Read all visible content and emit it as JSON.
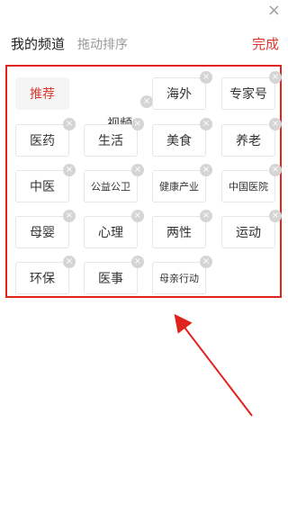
{
  "header": {
    "close_glyph": "×",
    "title": "我的频道",
    "subtitle": "拖动排序",
    "done_label": "完成"
  },
  "tiles": [
    {
      "id": "recommend",
      "label": "推荐",
      "removable": false,
      "style": "highlight"
    },
    {
      "id": "video",
      "label": "视频",
      "removable": true,
      "style": "floating"
    },
    {
      "id": "overseas",
      "label": "海外",
      "removable": true
    },
    {
      "id": "expert",
      "label": "专家号",
      "removable": true
    },
    {
      "id": "medicine",
      "label": "医药",
      "removable": true
    },
    {
      "id": "life",
      "label": "生活",
      "removable": true
    },
    {
      "id": "food",
      "label": "美食",
      "removable": true
    },
    {
      "id": "elderly",
      "label": "养老",
      "removable": true
    },
    {
      "id": "tcm",
      "label": "中医",
      "removable": true
    },
    {
      "id": "public-health",
      "label": "公益公卫",
      "removable": true,
      "small": true
    },
    {
      "id": "health-industry",
      "label": "健康产业",
      "removable": true,
      "small": true
    },
    {
      "id": "china-hospital",
      "label": "中国医院",
      "removable": true,
      "small": true
    },
    {
      "id": "maternal",
      "label": "母婴",
      "removable": true
    },
    {
      "id": "psychology",
      "label": "心理",
      "removable": true
    },
    {
      "id": "sex",
      "label": "两性",
      "removable": true
    },
    {
      "id": "sports",
      "label": "运动",
      "removable": true
    },
    {
      "id": "environment",
      "label": "环保",
      "removable": true
    },
    {
      "id": "medical-affairs",
      "label": "医事",
      "removable": true
    },
    {
      "id": "mother-action",
      "label": "母亲行动",
      "removable": true,
      "small": true
    }
  ],
  "remove_glyph": "×",
  "colors": {
    "accent": "#d8382f",
    "annotation": "#e0231d",
    "remove_badge": "#d5d5d5"
  }
}
